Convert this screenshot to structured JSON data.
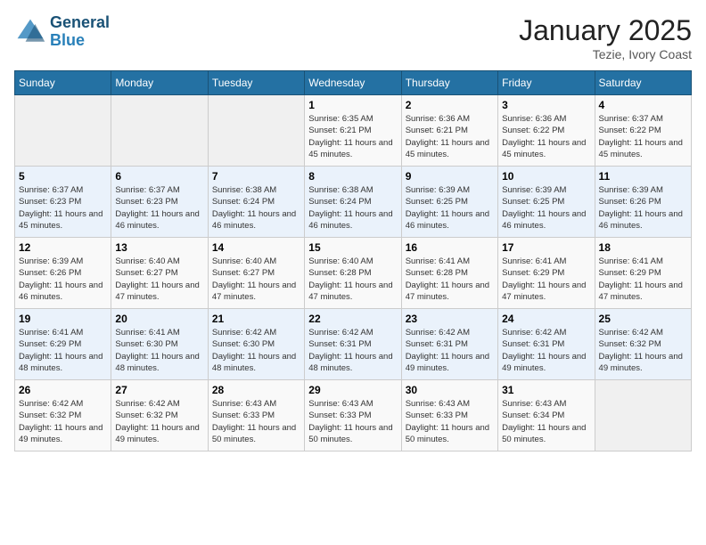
{
  "header": {
    "logo_line1": "General",
    "logo_line2": "Blue",
    "month": "January 2025",
    "location": "Tezie, Ivory Coast"
  },
  "weekdays": [
    "Sunday",
    "Monday",
    "Tuesday",
    "Wednesday",
    "Thursday",
    "Friday",
    "Saturday"
  ],
  "weeks": [
    [
      {
        "day": "",
        "info": ""
      },
      {
        "day": "",
        "info": ""
      },
      {
        "day": "",
        "info": ""
      },
      {
        "day": "1",
        "info": "Sunrise: 6:35 AM\nSunset: 6:21 PM\nDaylight: 11 hours and 45 minutes."
      },
      {
        "day": "2",
        "info": "Sunrise: 6:36 AM\nSunset: 6:21 PM\nDaylight: 11 hours and 45 minutes."
      },
      {
        "day": "3",
        "info": "Sunrise: 6:36 AM\nSunset: 6:22 PM\nDaylight: 11 hours and 45 minutes."
      },
      {
        "day": "4",
        "info": "Sunrise: 6:37 AM\nSunset: 6:22 PM\nDaylight: 11 hours and 45 minutes."
      }
    ],
    [
      {
        "day": "5",
        "info": "Sunrise: 6:37 AM\nSunset: 6:23 PM\nDaylight: 11 hours and 45 minutes."
      },
      {
        "day": "6",
        "info": "Sunrise: 6:37 AM\nSunset: 6:23 PM\nDaylight: 11 hours and 46 minutes."
      },
      {
        "day": "7",
        "info": "Sunrise: 6:38 AM\nSunset: 6:24 PM\nDaylight: 11 hours and 46 minutes."
      },
      {
        "day": "8",
        "info": "Sunrise: 6:38 AM\nSunset: 6:24 PM\nDaylight: 11 hours and 46 minutes."
      },
      {
        "day": "9",
        "info": "Sunrise: 6:39 AM\nSunset: 6:25 PM\nDaylight: 11 hours and 46 minutes."
      },
      {
        "day": "10",
        "info": "Sunrise: 6:39 AM\nSunset: 6:25 PM\nDaylight: 11 hours and 46 minutes."
      },
      {
        "day": "11",
        "info": "Sunrise: 6:39 AM\nSunset: 6:26 PM\nDaylight: 11 hours and 46 minutes."
      }
    ],
    [
      {
        "day": "12",
        "info": "Sunrise: 6:39 AM\nSunset: 6:26 PM\nDaylight: 11 hours and 46 minutes."
      },
      {
        "day": "13",
        "info": "Sunrise: 6:40 AM\nSunset: 6:27 PM\nDaylight: 11 hours and 47 minutes."
      },
      {
        "day": "14",
        "info": "Sunrise: 6:40 AM\nSunset: 6:27 PM\nDaylight: 11 hours and 47 minutes."
      },
      {
        "day": "15",
        "info": "Sunrise: 6:40 AM\nSunset: 6:28 PM\nDaylight: 11 hours and 47 minutes."
      },
      {
        "day": "16",
        "info": "Sunrise: 6:41 AM\nSunset: 6:28 PM\nDaylight: 11 hours and 47 minutes."
      },
      {
        "day": "17",
        "info": "Sunrise: 6:41 AM\nSunset: 6:29 PM\nDaylight: 11 hours and 47 minutes."
      },
      {
        "day": "18",
        "info": "Sunrise: 6:41 AM\nSunset: 6:29 PM\nDaylight: 11 hours and 47 minutes."
      }
    ],
    [
      {
        "day": "19",
        "info": "Sunrise: 6:41 AM\nSunset: 6:29 PM\nDaylight: 11 hours and 48 minutes."
      },
      {
        "day": "20",
        "info": "Sunrise: 6:41 AM\nSunset: 6:30 PM\nDaylight: 11 hours and 48 minutes."
      },
      {
        "day": "21",
        "info": "Sunrise: 6:42 AM\nSunset: 6:30 PM\nDaylight: 11 hours and 48 minutes."
      },
      {
        "day": "22",
        "info": "Sunrise: 6:42 AM\nSunset: 6:31 PM\nDaylight: 11 hours and 48 minutes."
      },
      {
        "day": "23",
        "info": "Sunrise: 6:42 AM\nSunset: 6:31 PM\nDaylight: 11 hours and 49 minutes."
      },
      {
        "day": "24",
        "info": "Sunrise: 6:42 AM\nSunset: 6:31 PM\nDaylight: 11 hours and 49 minutes."
      },
      {
        "day": "25",
        "info": "Sunrise: 6:42 AM\nSunset: 6:32 PM\nDaylight: 11 hours and 49 minutes."
      }
    ],
    [
      {
        "day": "26",
        "info": "Sunrise: 6:42 AM\nSunset: 6:32 PM\nDaylight: 11 hours and 49 minutes."
      },
      {
        "day": "27",
        "info": "Sunrise: 6:42 AM\nSunset: 6:32 PM\nDaylight: 11 hours and 49 minutes."
      },
      {
        "day": "28",
        "info": "Sunrise: 6:43 AM\nSunset: 6:33 PM\nDaylight: 11 hours and 50 minutes."
      },
      {
        "day": "29",
        "info": "Sunrise: 6:43 AM\nSunset: 6:33 PM\nDaylight: 11 hours and 50 minutes."
      },
      {
        "day": "30",
        "info": "Sunrise: 6:43 AM\nSunset: 6:33 PM\nDaylight: 11 hours and 50 minutes."
      },
      {
        "day": "31",
        "info": "Sunrise: 6:43 AM\nSunset: 6:34 PM\nDaylight: 11 hours and 50 minutes."
      },
      {
        "day": "",
        "info": ""
      }
    ]
  ]
}
